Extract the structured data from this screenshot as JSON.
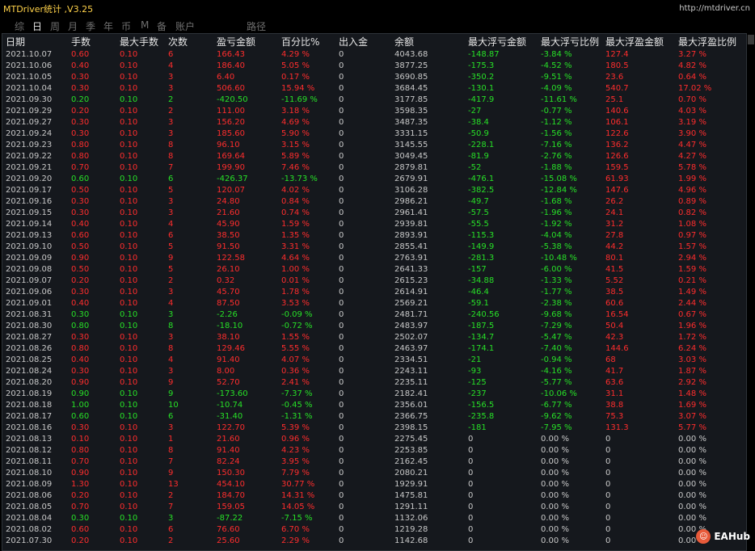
{
  "app": {
    "title": "MTDriver统计 ,V3.25",
    "url": "http://mtdriver.cn"
  },
  "tabs": [
    {
      "label": "综",
      "active": false
    },
    {
      "label": "日",
      "active": true
    },
    {
      "label": "周",
      "active": false
    },
    {
      "label": "月",
      "active": false
    },
    {
      "label": "季",
      "active": false
    },
    {
      "label": "年",
      "active": false
    },
    {
      "label": "币",
      "active": false
    },
    {
      "label": "M",
      "active": false
    },
    {
      "label": "备",
      "active": false
    },
    {
      "label": "账户",
      "active": false
    },
    {
      "label": "路径",
      "active": false
    }
  ],
  "table": {
    "headers": [
      "日期",
      "手数",
      "最大手数",
      "次数",
      "盈亏金额",
      "百分比%",
      "出入金",
      "余额",
      "最大浮亏金额",
      "最大浮亏比例",
      "最大浮盈金额",
      "最大浮盈比例"
    ],
    "rows": [
      [
        "2021.10.07",
        "0.60",
        "0.10",
        "6",
        "166.43",
        "4.29 %",
        "0",
        "4043.68",
        "-148.87",
        "-3.84 %",
        "127.4",
        "3.27 %"
      ],
      [
        "2021.10.06",
        "0.40",
        "0.10",
        "4",
        "186.40",
        "5.05 %",
        "0",
        "3877.25",
        "-175.3",
        "-4.52 %",
        "180.5",
        "4.82 %"
      ],
      [
        "2021.10.05",
        "0.30",
        "0.10",
        "3",
        "6.40",
        "0.17 %",
        "0",
        "3690.85",
        "-350.2",
        "-9.51 %",
        "23.6",
        "0.64 %"
      ],
      [
        "2021.10.04",
        "0.30",
        "0.10",
        "3",
        "506.60",
        "15.94 %",
        "0",
        "3684.45",
        "-130.1",
        "-4.09 %",
        "540.7",
        "17.02 %"
      ],
      [
        "2021.09.30",
        "0.20",
        "0.10",
        "2",
        "-420.50",
        "-11.69 %",
        "0",
        "3177.85",
        "-417.9",
        "-11.61 %",
        "25.1",
        "0.70 %"
      ],
      [
        "2021.09.29",
        "0.20",
        "0.10",
        "2",
        "111.00",
        "3.18 %",
        "0",
        "3598.35",
        "-27",
        "-0.77 %",
        "140.6",
        "4.03 %"
      ],
      [
        "2021.09.27",
        "0.30",
        "0.10",
        "3",
        "156.20",
        "4.69 %",
        "0",
        "3487.35",
        "-38.4",
        "-1.12 %",
        "106.1",
        "3.19 %"
      ],
      [
        "2021.09.24",
        "0.30",
        "0.10",
        "3",
        "185.60",
        "5.90 %",
        "0",
        "3331.15",
        "-50.9",
        "-1.56 %",
        "122.6",
        "3.90 %"
      ],
      [
        "2021.09.23",
        "0.80",
        "0.10",
        "8",
        "96.10",
        "3.15 %",
        "0",
        "3145.55",
        "-228.1",
        "-7.16 %",
        "136.2",
        "4.47 %"
      ],
      [
        "2021.09.22",
        "0.80",
        "0.10",
        "8",
        "169.64",
        "5.89 %",
        "0",
        "3049.45",
        "-81.9",
        "-2.76 %",
        "126.6",
        "4.27 %"
      ],
      [
        "2021.09.21",
        "0.70",
        "0.10",
        "7",
        "199.90",
        "7.46 %",
        "0",
        "2879.81",
        "-52",
        "-1.88 %",
        "159.5",
        "5.78 %"
      ],
      [
        "2021.09.20",
        "0.60",
        "0.10",
        "6",
        "-426.37",
        "-13.73 %",
        "0",
        "2679.91",
        "-476.1",
        "-15.08 %",
        "61.93",
        "1.99 %"
      ],
      [
        "2021.09.17",
        "0.50",
        "0.10",
        "5",
        "120.07",
        "4.02 %",
        "0",
        "3106.28",
        "-382.5",
        "-12.84 %",
        "147.6",
        "4.96 %"
      ],
      [
        "2021.09.16",
        "0.30",
        "0.10",
        "3",
        "24.80",
        "0.84 %",
        "0",
        "2986.21",
        "-49.7",
        "-1.68 %",
        "26.2",
        "0.89 %"
      ],
      [
        "2021.09.15",
        "0.30",
        "0.10",
        "3",
        "21.60",
        "0.74 %",
        "0",
        "2961.41",
        "-57.5",
        "-1.96 %",
        "24.1",
        "0.82 %"
      ],
      [
        "2021.09.14",
        "0.40",
        "0.10",
        "4",
        "45.90",
        "1.59 %",
        "0",
        "2939.81",
        "-55.5",
        "-1.92 %",
        "31.2",
        "1.08 %"
      ],
      [
        "2021.09.13",
        "0.60",
        "0.10",
        "6",
        "38.50",
        "1.35 %",
        "0",
        "2893.91",
        "-115.3",
        "-4.04 %",
        "27.8",
        "0.97 %"
      ],
      [
        "2021.09.10",
        "0.50",
        "0.10",
        "5",
        "91.50",
        "3.31 %",
        "0",
        "2855.41",
        "-149.9",
        "-5.38 %",
        "44.2",
        "1.57 %"
      ],
      [
        "2021.09.09",
        "0.90",
        "0.10",
        "9",
        "122.58",
        "4.64 %",
        "0",
        "2763.91",
        "-281.3",
        "-10.48 %",
        "80.1",
        "2.94 %"
      ],
      [
        "2021.09.08",
        "0.50",
        "0.10",
        "5",
        "26.10",
        "1.00 %",
        "0",
        "2641.33",
        "-157",
        "-6.00 %",
        "41.5",
        "1.59 %"
      ],
      [
        "2021.09.07",
        "0.20",
        "0.10",
        "2",
        "0.32",
        "0.01 %",
        "0",
        "2615.23",
        "-34.88",
        "-1.33 %",
        "5.52",
        "0.21 %"
      ],
      [
        "2021.09.06",
        "0.30",
        "0.10",
        "3",
        "45.70",
        "1.78 %",
        "0",
        "2614.91",
        "-46.4",
        "-1.77 %",
        "38.5",
        "1.49 %"
      ],
      [
        "2021.09.01",
        "0.40",
        "0.10",
        "4",
        "87.50",
        "3.53 %",
        "0",
        "2569.21",
        "-59.1",
        "-2.38 %",
        "60.6",
        "2.44 %"
      ],
      [
        "2021.08.31",
        "0.30",
        "0.10",
        "3",
        "-2.26",
        "-0.09 %",
        "0",
        "2481.71",
        "-240.56",
        "-9.68 %",
        "16.54",
        "0.67 %"
      ],
      [
        "2021.08.30",
        "0.80",
        "0.10",
        "8",
        "-18.10",
        "-0.72 %",
        "0",
        "2483.97",
        "-187.5",
        "-7.29 %",
        "50.4",
        "1.96 %"
      ],
      [
        "2021.08.27",
        "0.30",
        "0.10",
        "3",
        "38.10",
        "1.55 %",
        "0",
        "2502.07",
        "-134.7",
        "-5.47 %",
        "42.3",
        "1.72 %"
      ],
      [
        "2021.08.26",
        "0.80",
        "0.10",
        "8",
        "129.46",
        "5.55 %",
        "0",
        "2463.97",
        "-174.1",
        "-7.40 %",
        "144.6",
        "6.24 %"
      ],
      [
        "2021.08.25",
        "0.40",
        "0.10",
        "4",
        "91.40",
        "4.07 %",
        "0",
        "2334.51",
        "-21",
        "-0.94 %",
        "68",
        "3.03 %"
      ],
      [
        "2021.08.24",
        "0.30",
        "0.10",
        "3",
        "8.00",
        "0.36 %",
        "0",
        "2243.11",
        "-93",
        "-4.16 %",
        "41.7",
        "1.87 %"
      ],
      [
        "2021.08.20",
        "0.90",
        "0.10",
        "9",
        "52.70",
        "2.41 %",
        "0",
        "2235.11",
        "-125",
        "-5.77 %",
        "63.6",
        "2.92 %"
      ],
      [
        "2021.08.19",
        "0.90",
        "0.10",
        "9",
        "-173.60",
        "-7.37 %",
        "0",
        "2182.41",
        "-237",
        "-10.06 %",
        "31.1",
        "1.48 %"
      ],
      [
        "2021.08.18",
        "1.00",
        "0.10",
        "10",
        "-10.74",
        "-0.45 %",
        "0",
        "2356.01",
        "-156.5",
        "-6.77 %",
        "38.8",
        "1.69 %"
      ],
      [
        "2021.08.17",
        "0.60",
        "0.10",
        "6",
        "-31.40",
        "-1.31 %",
        "0",
        "2366.75",
        "-235.8",
        "-9.62 %",
        "75.3",
        "3.07 %"
      ],
      [
        "2021.08.16",
        "0.30",
        "0.10",
        "3",
        "122.70",
        "5.39 %",
        "0",
        "2398.15",
        "-181",
        "-7.95 %",
        "131.3",
        "5.77 %"
      ],
      [
        "2021.08.13",
        "0.10",
        "0.10",
        "1",
        "21.60",
        "0.96 %",
        "0",
        "2275.45",
        "0",
        "0.00 %",
        "0",
        "0.00 %"
      ],
      [
        "2021.08.12",
        "0.80",
        "0.10",
        "8",
        "91.40",
        "4.23 %",
        "0",
        "2253.85",
        "0",
        "0.00 %",
        "0",
        "0.00 %"
      ],
      [
        "2021.08.11",
        "0.70",
        "0.10",
        "7",
        "82.24",
        "3.95 %",
        "0",
        "2162.45",
        "0",
        "0.00 %",
        "0",
        "0.00 %"
      ],
      [
        "2021.08.10",
        "0.90",
        "0.10",
        "9",
        "150.30",
        "7.79 %",
        "0",
        "2080.21",
        "0",
        "0.00 %",
        "0",
        "0.00 %"
      ],
      [
        "2021.08.09",
        "1.30",
        "0.10",
        "13",
        "454.10",
        "30.77 %",
        "0",
        "1929.91",
        "0",
        "0.00 %",
        "0",
        "0.00 %"
      ],
      [
        "2021.08.06",
        "0.20",
        "0.10",
        "2",
        "184.70",
        "14.31 %",
        "0",
        "1475.81",
        "0",
        "0.00 %",
        "0",
        "0.00 %"
      ],
      [
        "2021.08.05",
        "0.70",
        "0.10",
        "7",
        "159.05",
        "14.05 %",
        "0",
        "1291.11",
        "0",
        "0.00 %",
        "0",
        "0.00 %"
      ],
      [
        "2021.08.04",
        "0.30",
        "0.10",
        "3",
        "-87.22",
        "-7.15 %",
        "0",
        "1132.06",
        "0",
        "0.00 %",
        "0",
        "0.00 %"
      ],
      [
        "2021.08.02",
        "0.60",
        "0.10",
        "6",
        "76.60",
        "6.70 %",
        "0",
        "1219.28",
        "0",
        "0.00 %",
        "0",
        "0.00 %"
      ],
      [
        "2021.07.30",
        "0.20",
        "0.10",
        "2",
        "25.60",
        "2.29 %",
        "0",
        "1142.68",
        "0",
        "0.00 %",
        "0",
        "0.00 %"
      ]
    ]
  },
  "watermark": {
    "text": "EAHub",
    "icon": "smiley-icon"
  },
  "colors": {
    "profit": "#ff2d2d",
    "loss": "#27e027",
    "neutral": "#c8c8c8",
    "title": "#ffd24a"
  }
}
